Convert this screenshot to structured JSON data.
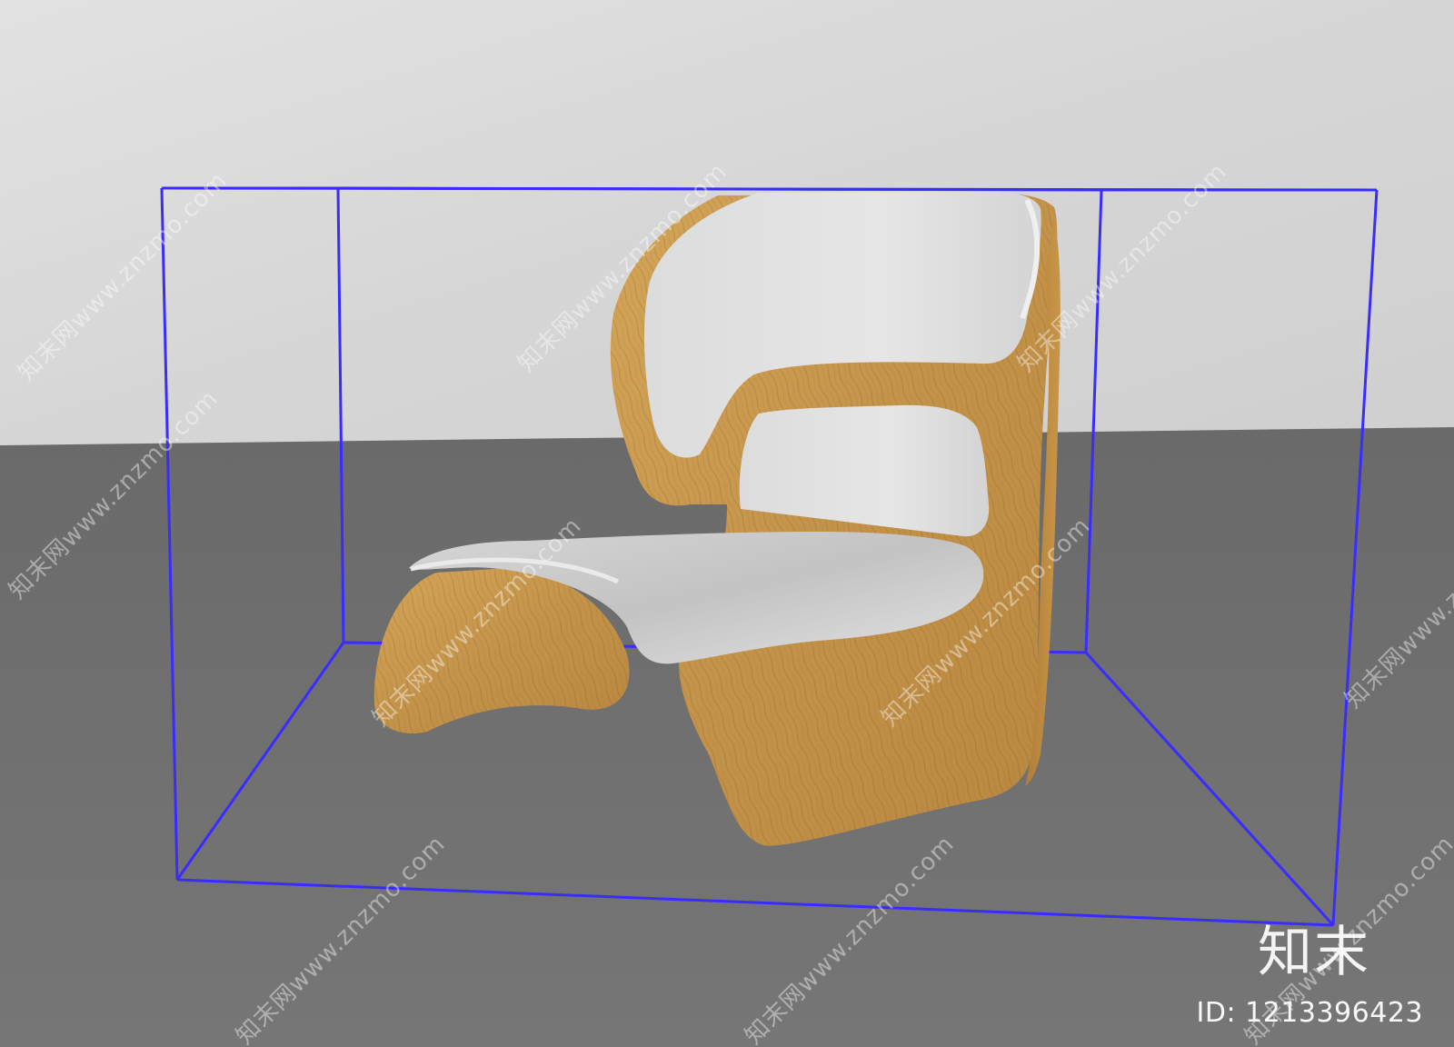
{
  "watermark": {
    "text": "知末网www.znzmo.com"
  },
  "brand": {
    "logo_text": "知末",
    "id_text": "ID: 1213396423"
  },
  "colors": {
    "wall": "#d9d9d9",
    "floor": "#6f6f6f",
    "wood": "#c99a4e",
    "upholstery": "#e2e2e2",
    "bounding_box": "#3a2cff"
  }
}
